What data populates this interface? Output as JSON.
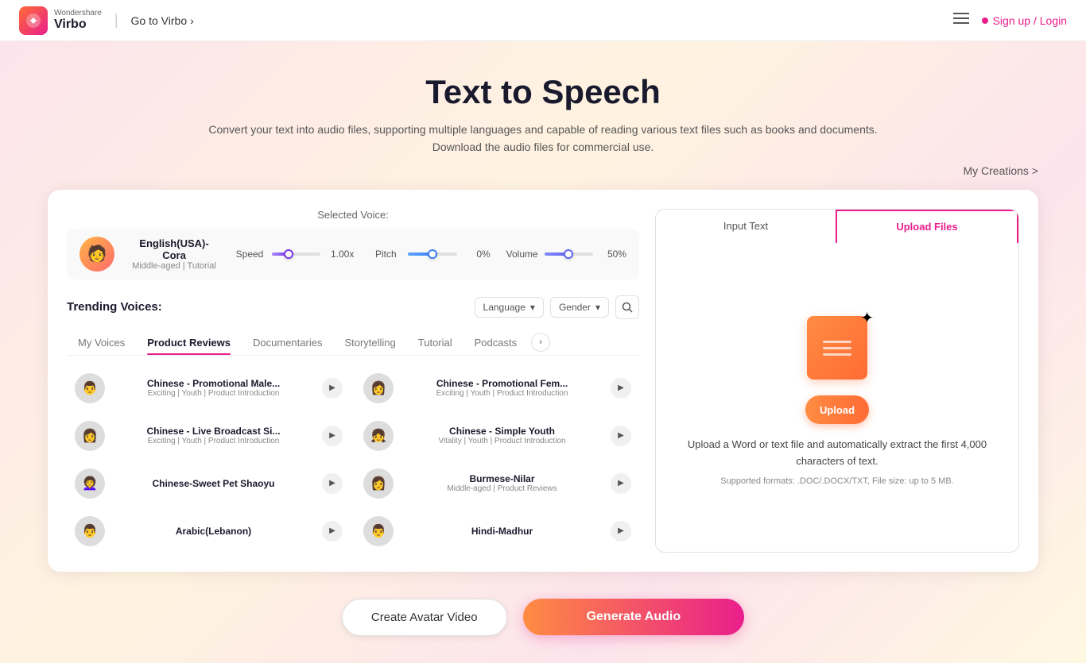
{
  "header": {
    "brand": "Wondershare",
    "product": "Virbo",
    "go_virbo": "Go to Virbo",
    "signup": "Sign up / Login",
    "menu_icon": "≡"
  },
  "hero": {
    "title": "Text to Speech",
    "subtitle": "Convert your text into audio files, supporting multiple languages and capable of reading various text files such as books and documents. Download the audio files for commercial use.",
    "my_creations": "My Creations >"
  },
  "voice_controls": {
    "selected_label": "Selected Voice:",
    "voice_name": "English(USA)-Cora",
    "voice_desc": "Middle-aged | Tutorial",
    "speed_label": "Speed",
    "speed_val": "1.00x",
    "pitch_label": "Pitch",
    "pitch_val": "0%",
    "volume_label": "Volume",
    "volume_val": "50%"
  },
  "trending": {
    "title": "Trending Voices:",
    "language_placeholder": "Language",
    "gender_placeholder": "Gender"
  },
  "tabs": [
    {
      "id": "my-voices",
      "label": "My Voices",
      "active": false
    },
    {
      "id": "product-reviews",
      "label": "Product Reviews",
      "active": true
    },
    {
      "id": "documentaries",
      "label": "Documentaries",
      "active": false
    },
    {
      "id": "storytelling",
      "label": "Storytelling",
      "active": false
    },
    {
      "id": "tutorial",
      "label": "Tutorial",
      "active": false
    },
    {
      "id": "podcasts",
      "label": "Podcasts",
      "active": false
    }
  ],
  "voices": [
    {
      "name": "Chinese - Promotional Male...",
      "desc": "Exciting | Youth | Product Introduction",
      "avatar": "👨"
    },
    {
      "name": "Chinese - Promotional Fem...",
      "desc": "Exciting | Youth | Product Introduction",
      "avatar": "👩"
    },
    {
      "name": "Chinese - Live Broadcast Si...",
      "desc": "Exciting | Youth | Product Introduction",
      "avatar": "👩"
    },
    {
      "name": "Chinese - Simple Youth",
      "desc": "Vitality | Youth | Product Introduction",
      "avatar": "👧"
    },
    {
      "name": "Chinese-Sweet Pet Shaoyu",
      "desc": "",
      "avatar": "👩‍🦱"
    },
    {
      "name": "Burmese-Nilar",
      "desc": "Middle-aged | Product Reviews",
      "avatar": "👩"
    },
    {
      "name": "Arabic(Lebanon)",
      "desc": "",
      "avatar": "👨"
    },
    {
      "name": "Hindi-Madhur",
      "desc": "",
      "avatar": "👨"
    }
  ],
  "right_panel": {
    "input_text_label": "Input Text",
    "upload_files_label": "Upload Files",
    "active_tab": "upload",
    "upload_btn_label": "Upload",
    "upload_desc": "Upload a Word or text file and automatically extract the first 4,000 characters of text.",
    "upload_formats": "Supported formats: .DOC/.DOCX/TXT, File size: up to 5 MB."
  },
  "bottom": {
    "create_avatar": "Create Avatar Video",
    "generate_audio": "Generate Audio"
  }
}
